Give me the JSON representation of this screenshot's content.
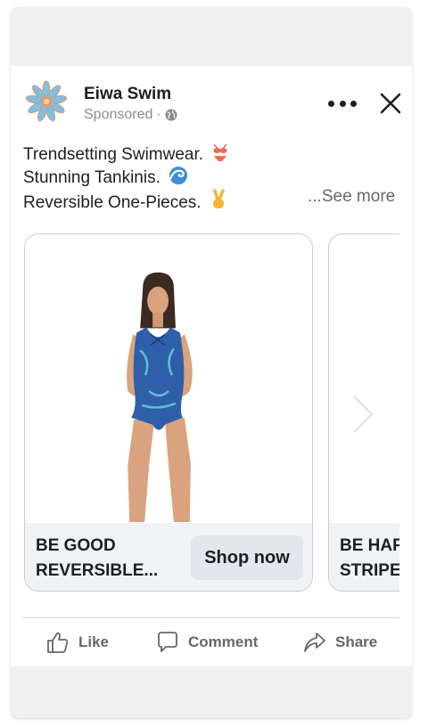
{
  "post": {
    "page_name": "Eiwa Swim",
    "sponsored": "Sponsored",
    "sponsored_sep": "·",
    "text_lines": [
      "Trendsetting Swimwear.",
      "Stunning Tankinis.",
      "Reversible One-Pieces."
    ],
    "see_more": "...See more"
  },
  "carousel": {
    "items": [
      {
        "title_line1": "BE GOOD",
        "title_line2": "REVERSIBLE...",
        "cta": "Shop now"
      },
      {
        "title_line1": "BE HAP",
        "title_line2": "STRIPE"
      }
    ]
  },
  "actions": {
    "like": "Like",
    "comment": "Comment",
    "share": "Share"
  },
  "colors": {
    "brand_avatar": "#e8a06a",
    "avatar_inner": "#6ab0d8",
    "swimsuit": "#2f5fa8",
    "muted_text": "#65676b"
  },
  "icons": [
    "avatar-logo",
    "globe-icon",
    "more-icon",
    "close-icon",
    "bikini-emoji",
    "wave-emoji",
    "victory-emoji",
    "chevron-right-icon",
    "like-icon",
    "comment-icon",
    "share-icon"
  ]
}
